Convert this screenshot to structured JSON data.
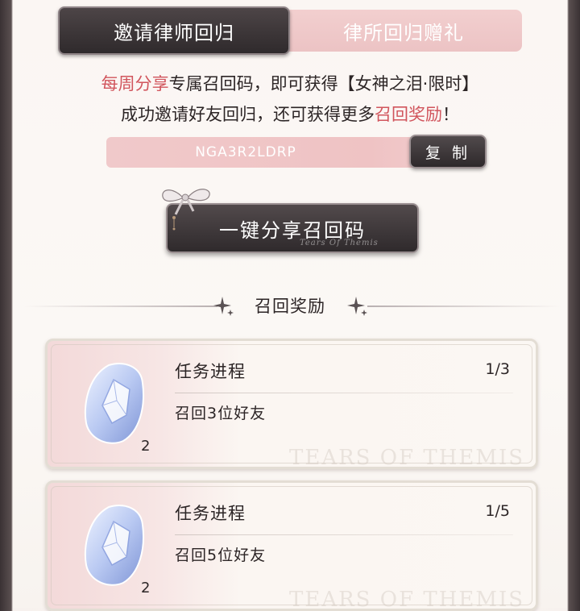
{
  "tabs": [
    {
      "label": "邀请律师回归",
      "active": true
    },
    {
      "label": "律所回归赠礼",
      "active": false
    }
  ],
  "intro": {
    "line1_highlight": "每周分享",
    "line1_text": "专属召回码，即可获得【女神之泪·限时】",
    "line2_text": "成功邀请好友回归，还可获得更多",
    "line2_highlight": "召回奖励",
    "line2_end": "！"
  },
  "invite_code": {
    "code": "NGA3R2LDRP",
    "copy_label": "复 制"
  },
  "share_button": {
    "label": "一键分享召回码",
    "script": "Tears Of Themis"
  },
  "rewards_section": {
    "title": "召回奖励"
  },
  "tasks": [
    {
      "title": "任务进程",
      "progress": "1/3",
      "description": "召回3位好友",
      "reward_count": "2",
      "watermark": "TEARS OF THEMIS"
    },
    {
      "title": "任务进程",
      "progress": "1/5",
      "description": "召回5位好友",
      "reward_count": "2",
      "watermark": "TEARS OF THEMIS"
    }
  ],
  "colors": {
    "highlight": "#d1555d",
    "dark_button": "#2f2a2c",
    "pink_tab": "#ecc3c4"
  },
  "icons": [
    "bow-icon",
    "sparkle-icon",
    "gem-icon"
  ]
}
